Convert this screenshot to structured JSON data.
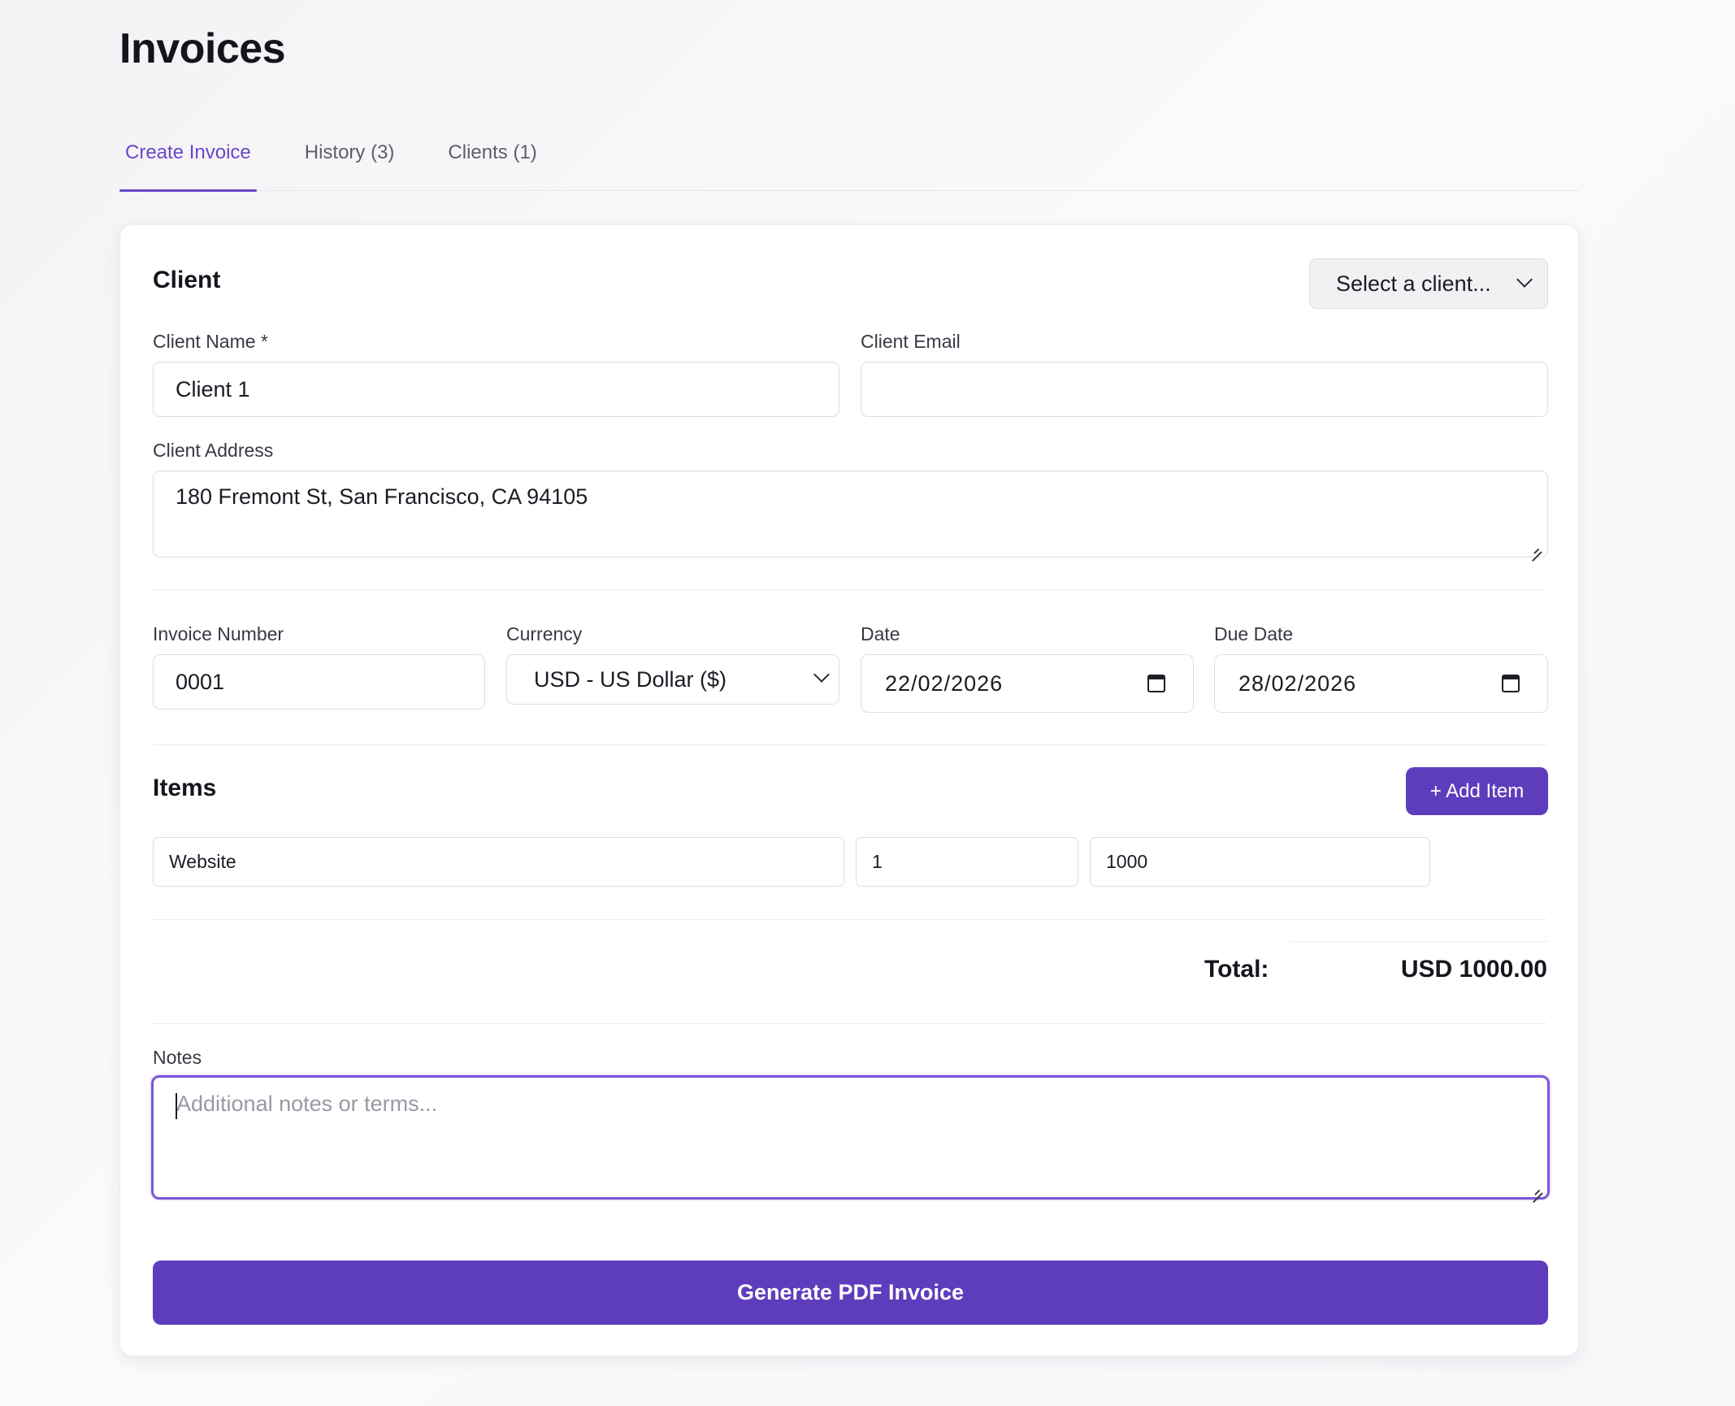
{
  "page": {
    "title": "Invoices"
  },
  "tabs": [
    {
      "label": "Create Invoice",
      "active": true
    },
    {
      "label": "History (3)",
      "active": false
    },
    {
      "label": "Clients (1)",
      "active": false
    }
  ],
  "client_section": {
    "title": "Client",
    "client_select": {
      "value": "Select a client..."
    },
    "client_name": {
      "label": "Client Name *",
      "value": "Client 1"
    },
    "client_email": {
      "label": "Client Email",
      "value": ""
    },
    "client_address": {
      "label": "Client Address",
      "value": "180 Fremont St, San Francisco, CA 94105"
    }
  },
  "invoice_meta": {
    "invoice_number": {
      "label": "Invoice Number",
      "value": "0001"
    },
    "currency": {
      "label": "Currency",
      "value": "USD - US Dollar ($)"
    },
    "date": {
      "label": "Date",
      "value": "22/02/2026"
    },
    "due_date": {
      "label": "Due Date",
      "value": "28/02/2026"
    }
  },
  "items_section": {
    "title": "Items",
    "add_button": "+ Add Item",
    "items": [
      {
        "description": "Website",
        "quantity": "1",
        "price": "1000"
      }
    ]
  },
  "total": {
    "label": "Total:",
    "value": "USD 1000.00"
  },
  "notes": {
    "label": "Notes",
    "value": "",
    "placeholder": "Additional notes or terms..."
  },
  "generate_button": "Generate PDF Invoice",
  "icons": {
    "chevron": "chevron-down-icon",
    "calendar": "calendar-icon",
    "resize": "resize-handle-icon"
  },
  "colors": {
    "accent": "#5e3dbc",
    "tab_active": "#6a46c8",
    "focus_border": "#7b56d8"
  }
}
